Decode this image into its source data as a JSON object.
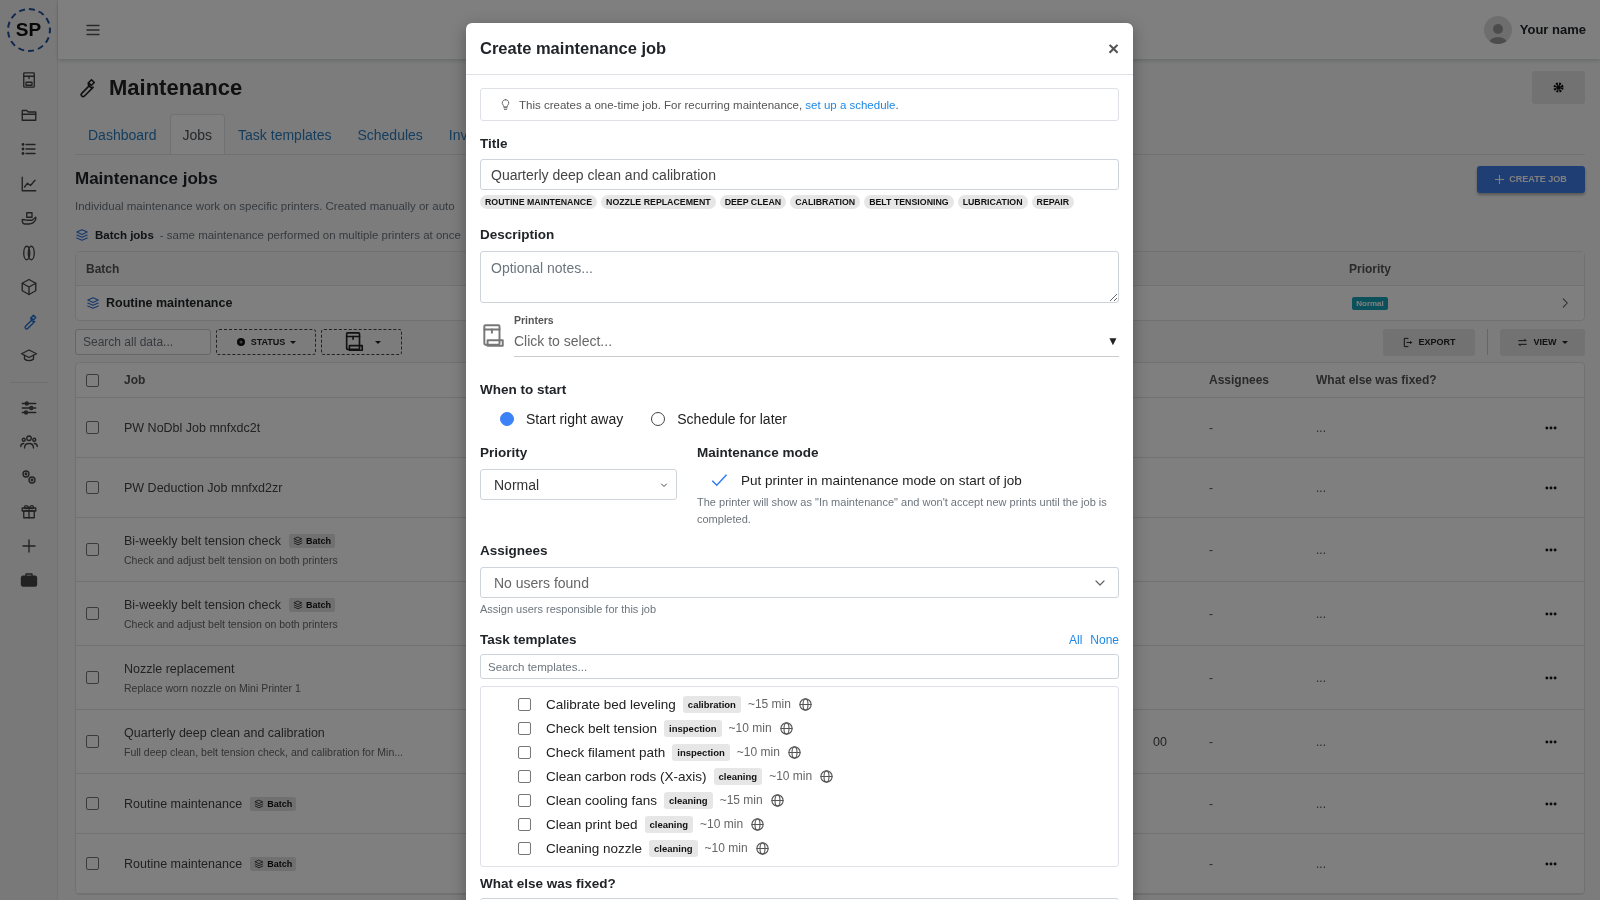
{
  "sidebar": {
    "logo": "SP",
    "items": [
      {
        "selected": false
      },
      {
        "selected": false
      },
      {
        "selected": false
      },
      {
        "selected": false
      },
      {
        "selected": false
      },
      {
        "selected": false
      },
      {
        "selected": false
      },
      {
        "selected": true
      },
      {
        "selected": false
      },
      {
        "selected": false
      },
      {
        "selected": false
      },
      {
        "selected": false
      },
      {
        "selected": false
      },
      {
        "selected": false
      },
      {
        "selected": false
      }
    ]
  },
  "topbar": {
    "user": "Your name"
  },
  "page": {
    "title": "Maintenance",
    "tabs": [
      {
        "label": "Dashboard",
        "selected": false
      },
      {
        "label": "Jobs",
        "selected": true
      },
      {
        "label": "Task templates",
        "selected": false
      },
      {
        "label": "Schedules",
        "selected": false
      },
      {
        "label": "Inv",
        "selected": false
      }
    ],
    "heading": "Maintenance jobs",
    "create_button": "CREATE JOB",
    "subtitle": "Individual maintenance work on specific printers. Created manually or auto",
    "batch_note": {
      "label": "Batch jobs",
      "text": "- same maintenance performed on multiple printers at once"
    },
    "batch_table": {
      "columns": [
        "Batch",
        "Priority"
      ],
      "rows": [
        {
          "name": "Routine maintenance",
          "priority": "Normal"
        }
      ]
    },
    "toolbar": {
      "search_placeholder": "Search all data...",
      "status": "STATUS",
      "export": "EXPORT",
      "view": "VIEW"
    },
    "jobs_table": {
      "header_checked": false,
      "columns": [
        "Job",
        "Assignees",
        "What else was fixed?"
      ],
      "rows": [
        {
          "title": "PW NoDbl Job mnfxdc2t",
          "checked": false,
          "assignees": "-",
          "fixed": "..."
        },
        {
          "title": "PW Deduction Job mnfxd2zr",
          "checked": false,
          "assignees": "-",
          "fixed": "..."
        },
        {
          "title": "Bi-weekly belt tension check",
          "badge": "Batch",
          "subtitle": "Check and adjust belt tension on both printers",
          "checked": false,
          "assignees": "-",
          "fixed": "..."
        },
        {
          "title": "Bi-weekly belt tension check",
          "badge": "Batch",
          "subtitle": "Check and adjust belt tension on both printers",
          "checked": false,
          "assignees": "-",
          "fixed": "..."
        },
        {
          "title": "Nozzle replacement",
          "subtitle": "Replace worn nozzle on Mini Printer 1",
          "checked": false,
          "assignees": "-",
          "fixed": "..."
        },
        {
          "title": "Quarterly deep clean and calibration",
          "subtitle": "Full deep clean, belt tension check, and calibration for Min...",
          "column_3": "00",
          "checked": false,
          "assignees": "-",
          "fixed": "..."
        },
        {
          "title": "Routine maintenance",
          "badge": "Batch",
          "checked": false,
          "assignees": "-",
          "fixed": "..."
        },
        {
          "title": "Routine maintenance",
          "badge": "Batch",
          "checked": false,
          "assignees": "-",
          "fixed": "..."
        }
      ]
    }
  },
  "modal": {
    "title": "Create maintenance job",
    "close": "×",
    "info": {
      "text": "This creates a one-time job. For recurring maintenance,",
      "link": "set up a schedule",
      "end": "."
    },
    "title_field": {
      "label": "Title",
      "value": "Quarterly deep clean and calibration"
    },
    "tags": [
      "ROUTINE MAINTENANCE",
      "NOZZLE REPLACEMENT",
      "DEEP CLEAN",
      "CALIBRATION",
      "BELT TENSIONING",
      "LUBRICATION",
      "REPAIR"
    ],
    "description": {
      "label": "Description",
      "placeholder": "Optional notes..."
    },
    "printers": {
      "label": "Printers",
      "placeholder": "Click to select...",
      "caret": "▼"
    },
    "when_to_start": {
      "label": "When to start",
      "options": [
        {
          "label": "Start right away",
          "selected": true
        },
        {
          "label": "Schedule for later",
          "selected": false
        }
      ]
    },
    "priority": {
      "label": "Priority",
      "value": "Normal"
    },
    "maintenance_mode": {
      "label": "Maintenance mode",
      "checkbox_label": "Put printer in maintenance mode on start of job",
      "checked": true,
      "help": "The printer will show as \"In maintenance\" and won't accept new prints until the job is completed."
    },
    "assignees": {
      "label": "Assignees",
      "value": "No users found",
      "help": "Assign users responsible for this job"
    },
    "task_templates": {
      "label": "Task templates",
      "all": "All",
      "none": "None",
      "search_placeholder": "Search templates...",
      "items": [
        {
          "name": "Calibrate bed leveling",
          "tag": "calibration",
          "duration": "~15 min",
          "checked": false
        },
        {
          "name": "Check belt tension",
          "tag": "inspection",
          "duration": "~10 min",
          "checked": false
        },
        {
          "name": "Check filament path",
          "tag": "inspection",
          "duration": "~10 min",
          "checked": false
        },
        {
          "name": "Clean carbon rods (X-axis)",
          "tag": "cleaning",
          "duration": "~10 min",
          "checked": false
        },
        {
          "name": "Clean cooling fans",
          "tag": "cleaning",
          "duration": "~15 min",
          "checked": false
        },
        {
          "name": "Clean print bed",
          "tag": "cleaning",
          "duration": "~10 min",
          "checked": false
        },
        {
          "name": "Cleaning nozzle",
          "tag": "cleaning",
          "duration": "~10 min",
          "checked": false
        }
      ]
    },
    "what_else": {
      "label": "What else was fixed?"
    }
  }
}
